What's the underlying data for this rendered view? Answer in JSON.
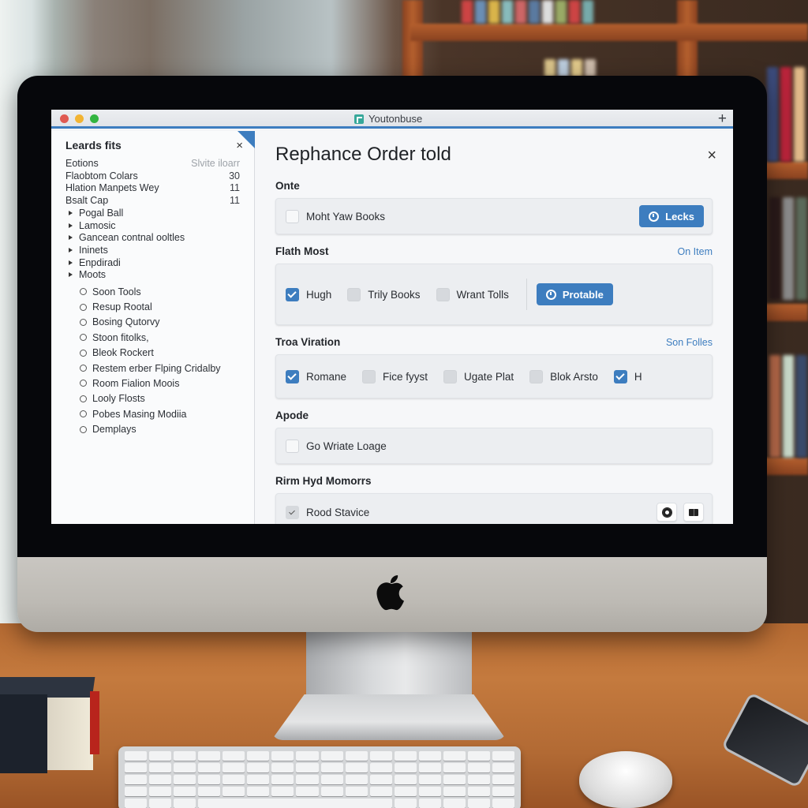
{
  "window": {
    "tab_title": "Youtonbuse",
    "new_tab_symbol": "+",
    "traffic_lights": [
      "close",
      "minimize",
      "zoom"
    ],
    "accent_color": "#3d7dbf"
  },
  "sidebar": {
    "title": "Leards fits",
    "close_symbol": "×",
    "rows": [
      {
        "label": "Eotions",
        "value": "Slvite iloarr",
        "muted": true
      },
      {
        "label": "Flaobtom Colars",
        "value": "30"
      },
      {
        "label": "Hlation Manpets Wey",
        "value": "11"
      },
      {
        "label": "Bsalt Cap",
        "value": "11"
      }
    ],
    "tree": [
      {
        "label": "Pogal Ball"
      },
      {
        "label": "Lamosic"
      },
      {
        "label": "Gancean contnal ooltles"
      },
      {
        "label": "Ininets"
      },
      {
        "label": "Enpdiradi"
      },
      {
        "label": "Moots"
      }
    ],
    "radios": [
      {
        "label": "Soon Tools"
      },
      {
        "label": "Resup Rootal"
      },
      {
        "label": "Bosing Qutorvy"
      },
      {
        "label": "Stoon fitolks,"
      },
      {
        "label": "Bleok Rockert"
      },
      {
        "label": "Restem erber Flping Cridalby"
      },
      {
        "label": "Room Fialion Moois"
      },
      {
        "label": "Looly Flosts"
      },
      {
        "label": "Pobes Masing Modiia"
      },
      {
        "label": "Demplays"
      }
    ]
  },
  "main": {
    "title": "Rephance Order told",
    "close_symbol": "×",
    "sections": [
      {
        "heading": "Onte",
        "link": "",
        "options": [
          {
            "label": "Moht Yaw Books",
            "checked": false
          }
        ],
        "button": {
          "label": "Lecks",
          "icon": "clock-icon"
        }
      },
      {
        "heading": "Flath Most",
        "link": "On Item",
        "options": [
          {
            "label": "Hugh",
            "checked": true
          },
          {
            "label": "Trily Books",
            "checked": false
          },
          {
            "label": "Wrant Tolls",
            "checked": false
          }
        ],
        "button": {
          "label": "Protable",
          "icon": "target-icon"
        }
      },
      {
        "heading": "Troa Viration",
        "link": "Son Folles",
        "options": [
          {
            "label": "Romane",
            "checked": true
          },
          {
            "label": "Fice fyyst",
            "checked": false
          },
          {
            "label": "Ugate Plat",
            "checked": false
          },
          {
            "label": "Blok Arsto",
            "checked": false
          },
          {
            "label": "H",
            "checked": true
          }
        ]
      },
      {
        "heading": "Apode",
        "link": "",
        "options": [
          {
            "label": "Go Wriate Loage",
            "checked": false
          }
        ]
      },
      {
        "heading": "Rirm Hyd Momorrs",
        "link": "",
        "options": [
          {
            "label": "Rood Stavice",
            "checked": true,
            "muted": true
          }
        ],
        "icon_buttons": [
          "gear-icon",
          "book-icon"
        ]
      }
    ]
  }
}
